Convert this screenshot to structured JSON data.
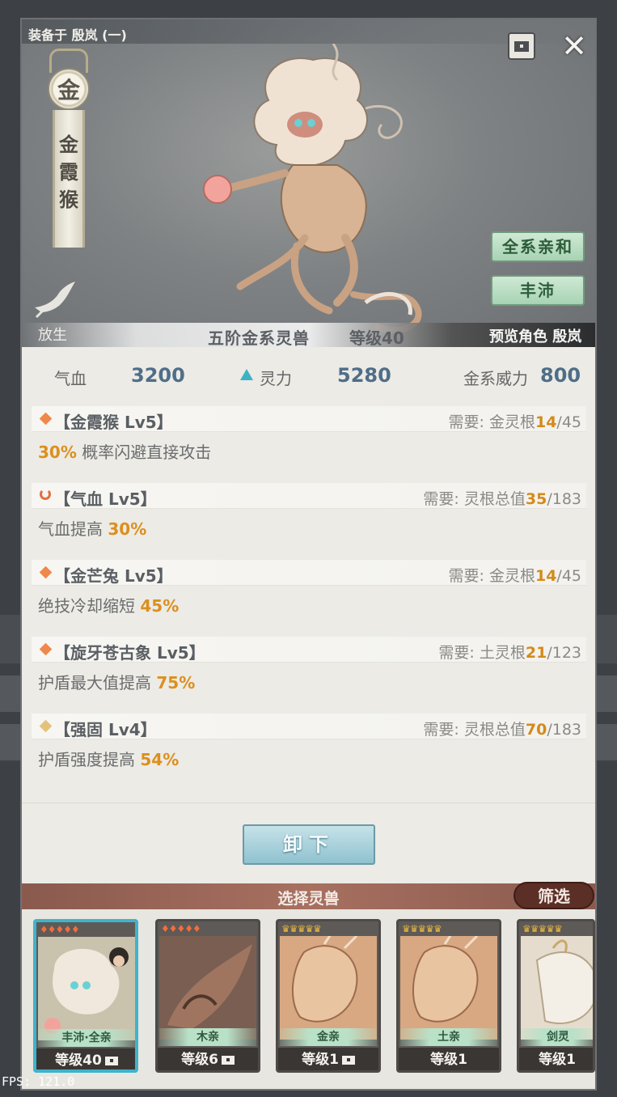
{
  "header": {
    "equipped_label": "装备于 殷岚 (一)",
    "element": "金",
    "name_chars": [
      "金",
      "霞",
      "猴"
    ],
    "release_label": "放生",
    "tag_all": "全系亲和",
    "tag_owner": "丰沛",
    "rank": "五阶金系灵兽",
    "level": "等级40",
    "preview": "预览角色 殷岚"
  },
  "stats": {
    "hp_label": "气血",
    "hp_value": "3200",
    "sp_label": "灵力",
    "sp_value": "5280",
    "power_label": "金系威力",
    "power_value": "800"
  },
  "skills": [
    {
      "name": "【金霞猴 Lv5】",
      "req_prefix": "需要:  金灵根",
      "req_cur": "14",
      "req_max": "/45",
      "desc_pre": "",
      "pct": "30%",
      "desc_post": " 概率闪避直接攻击",
      "icon_color": "#f0874b"
    },
    {
      "name": "【气血 Lv5】",
      "req_prefix": "需要:  灵根总值",
      "req_cur": "35",
      "req_max": "/183",
      "desc_pre": "气血提高 ",
      "pct": "30%",
      "desc_post": "",
      "icon_color": "#e07040"
    },
    {
      "name": "【金芒兔 Lv5】",
      "req_prefix": "需要:  金灵根",
      "req_cur": "14",
      "req_max": "/45",
      "desc_pre": "绝技冷却缩短 ",
      "pct": "45%",
      "desc_post": "",
      "icon_color": "#f0874b"
    },
    {
      "name": "【旋牙苍古象 Lv5】",
      "req_prefix": "需要:  土灵根",
      "req_cur": "21",
      "req_max": "/123",
      "desc_pre": "护盾最大值提高 ",
      "pct": "75%",
      "desc_post": "",
      "icon_color": "#f0874b"
    },
    {
      "name": "【强固 Lv4】",
      "req_prefix": "需要:  灵根总值",
      "req_cur": "70",
      "req_max": "/183",
      "desc_pre": "护盾强度提高 ",
      "pct": "54%",
      "desc_post": "",
      "icon_color": "#e3c27a"
    }
  ],
  "unequip_label": "卸下",
  "selector": {
    "title": "选择灵兽",
    "filter_label": "筛选",
    "cards": [
      {
        "tag": "丰沛·全亲",
        "level": "等级40",
        "stars": "♦♦♦♦♦",
        "star_color": "#f06e3c"
      },
      {
        "tag": "木亲",
        "level": "等级6",
        "stars": "♦♦♦♦♦",
        "star_color": "#f06e3c"
      },
      {
        "tag": "金亲",
        "level": "等级1",
        "stars": "♛♛♛♛♛",
        "star_color": "#e6b640"
      },
      {
        "tag": "土亲",
        "level": "等级1",
        "stars": "♛♛♛♛♛",
        "star_color": "#e6b640"
      },
      {
        "tag": "剑灵",
        "level": "等级1",
        "stars": "♛♛♛♛♛",
        "star_color": "#e6b640"
      }
    ]
  },
  "fps": "FPS: 121.0"
}
